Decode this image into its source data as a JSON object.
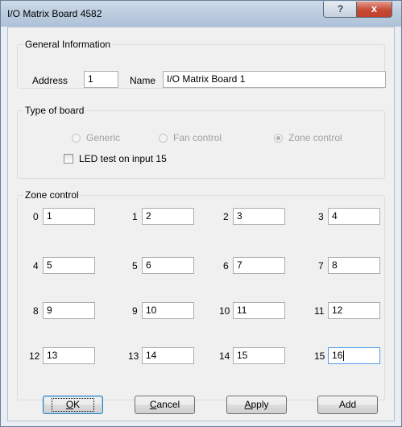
{
  "window": {
    "title": "I/O Matrix Board 4582",
    "help_glyph": "?",
    "close_glyph": "x"
  },
  "general": {
    "legend": "General Information",
    "address_label": "Address",
    "address_value": "1",
    "name_label": "Name",
    "name_value": "I/O Matrix Board 1"
  },
  "board_type": {
    "legend": "Type of board",
    "options": [
      {
        "label": "Generic",
        "selected": false
      },
      {
        "label": "Fan control",
        "selected": false
      },
      {
        "label": "Zone control",
        "selected": true
      }
    ],
    "led_test_label": "LED test on input 15",
    "led_test_checked": false
  },
  "zone": {
    "legend": "Zone control",
    "fields": [
      {
        "label": "0",
        "value": "1"
      },
      {
        "label": "1",
        "value": "2"
      },
      {
        "label": "2",
        "value": "3"
      },
      {
        "label": "3",
        "value": "4"
      },
      {
        "label": "4",
        "value": "5"
      },
      {
        "label": "5",
        "value": "6"
      },
      {
        "label": "6",
        "value": "7"
      },
      {
        "label": "7",
        "value": "8"
      },
      {
        "label": "8",
        "value": "9"
      },
      {
        "label": "9",
        "value": "10"
      },
      {
        "label": "10",
        "value": "11"
      },
      {
        "label": "11",
        "value": "12"
      },
      {
        "label": "12",
        "value": "13"
      },
      {
        "label": "13",
        "value": "14"
      },
      {
        "label": "14",
        "value": "15"
      },
      {
        "label": "15",
        "value": "16"
      }
    ]
  },
  "buttons": {
    "ok": {
      "mnemonic": "O",
      "rest": "K"
    },
    "cancel": {
      "mnemonic": "C",
      "rest": "ancel"
    },
    "apply": {
      "mnemonic": "A",
      "rest": "pply"
    },
    "add": {
      "label": "Add"
    }
  }
}
